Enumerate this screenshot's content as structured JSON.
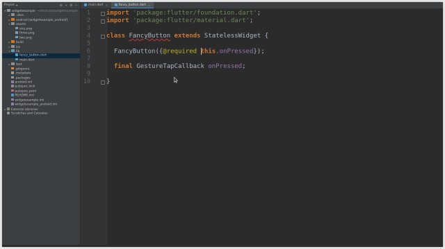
{
  "project_panel": {
    "title": "Project",
    "caret": "▾",
    "tools": [
      "⊕",
      "÷",
      "⚙",
      "⊢"
    ],
    "tree": [
      {
        "indent": 0,
        "arrow": "▾",
        "icon": "folder",
        "label": "widgetexample",
        "muted": "~/dev/cats/widgetexample"
      },
      {
        "indent": 1,
        "arrow": "▸",
        "icon": "folder",
        "label": ".idea",
        "muted": ""
      },
      {
        "indent": 1,
        "arrow": "▸",
        "icon": "folder-orange",
        "label": "android [widgetexample_android]",
        "muted": ""
      },
      {
        "indent": 1,
        "arrow": "▾",
        "icon": "folder",
        "label": "assets",
        "muted": ""
      },
      {
        "indent": 2,
        "arrow": "",
        "icon": "image",
        "label": "one.png",
        "muted": ""
      },
      {
        "indent": 2,
        "arrow": "",
        "icon": "image",
        "label": "three.png",
        "muted": ""
      },
      {
        "indent": 2,
        "arrow": "",
        "icon": "image",
        "label": "two.png",
        "muted": ""
      },
      {
        "indent": 1,
        "arrow": "▸",
        "icon": "folder-orange",
        "label": "build",
        "muted": ""
      },
      {
        "indent": 1,
        "arrow": "▸",
        "icon": "folder",
        "label": "ios",
        "muted": ""
      },
      {
        "indent": 1,
        "arrow": "▾",
        "icon": "folder-blue",
        "label": "lib",
        "muted": ""
      },
      {
        "indent": 2,
        "arrow": "",
        "icon": "dart",
        "label": "fancy_button.dart",
        "muted": "",
        "selected": true
      },
      {
        "indent": 2,
        "arrow": "",
        "icon": "dart",
        "label": "main.dart",
        "muted": ""
      },
      {
        "indent": 1,
        "arrow": "▸",
        "icon": "folder",
        "label": "test",
        "muted": ""
      },
      {
        "indent": 1,
        "arrow": "",
        "icon": "gitfile",
        "label": ".gitignore",
        "muted": ""
      },
      {
        "indent": 1,
        "arrow": "",
        "icon": "file",
        "label": ".metadata",
        "muted": ""
      },
      {
        "indent": 1,
        "arrow": "",
        "icon": "file",
        "label": ".packages",
        "muted": ""
      },
      {
        "indent": 1,
        "arrow": "",
        "icon": "iml",
        "label": "android.iml",
        "muted": ""
      },
      {
        "indent": 1,
        "arrow": "",
        "icon": "lock",
        "label": "pubspec.lock",
        "muted": ""
      },
      {
        "indent": 1,
        "arrow": "",
        "icon": "yaml",
        "label": "pubspec.yaml",
        "muted": ""
      },
      {
        "indent": 1,
        "arrow": "",
        "icon": "md",
        "label": "README.md",
        "muted": ""
      },
      {
        "indent": 1,
        "arrow": "",
        "icon": "iml",
        "label": "widgetexample.iml",
        "muted": ""
      },
      {
        "indent": 1,
        "arrow": "",
        "icon": "iml",
        "label": "widgetexample_android.iml",
        "muted": ""
      },
      {
        "indent": 0,
        "arrow": "▸",
        "icon": "lib",
        "label": "External Libraries",
        "muted": ""
      },
      {
        "indent": 0,
        "arrow": "",
        "icon": "scratch",
        "label": "Scratches and Consoles",
        "muted": ""
      }
    ]
  },
  "tabs": [
    {
      "label": "main.dart",
      "icon": "dart",
      "close": "×",
      "active": false
    },
    {
      "label": "fancy_button.dart",
      "icon": "dart",
      "close": "×",
      "active": true
    }
  ],
  "editor": {
    "line_numbers": [
      "1",
      "2",
      "3",
      "4",
      "5",
      "6",
      "7",
      "8",
      "9",
      "10"
    ],
    "line1": {
      "kw": "import",
      "str": "'package:flutter/foundation.dart'",
      "end": ";"
    },
    "line2": {
      "kw": "import",
      "str": "'package:flutter/material.dart'",
      "end": ";"
    },
    "line4": {
      "kw1": "class",
      "cls": "FancyButton",
      "kw2": "extends",
      "base": "StatelessWidget",
      "brace": "{"
    },
    "line6": {
      "ctor": "FancyButton",
      "open": "({",
      "ann": "@required",
      "this": "this",
      "field": ".onPressed",
      "close": "});"
    },
    "line8": {
      "kw": "final",
      "type": "GestureTapCallback",
      "field": "onPressed",
      "end": ";"
    },
    "line10": {
      "brace": "}"
    }
  },
  "colors": {
    "editor_bg": "#2b2b2b",
    "panel_bg": "#3c3f41",
    "keyword": "#cc7832",
    "string": "#6a8759",
    "field": "#9876aa",
    "annotation": "#bbb529",
    "selection": "#0d293e"
  }
}
